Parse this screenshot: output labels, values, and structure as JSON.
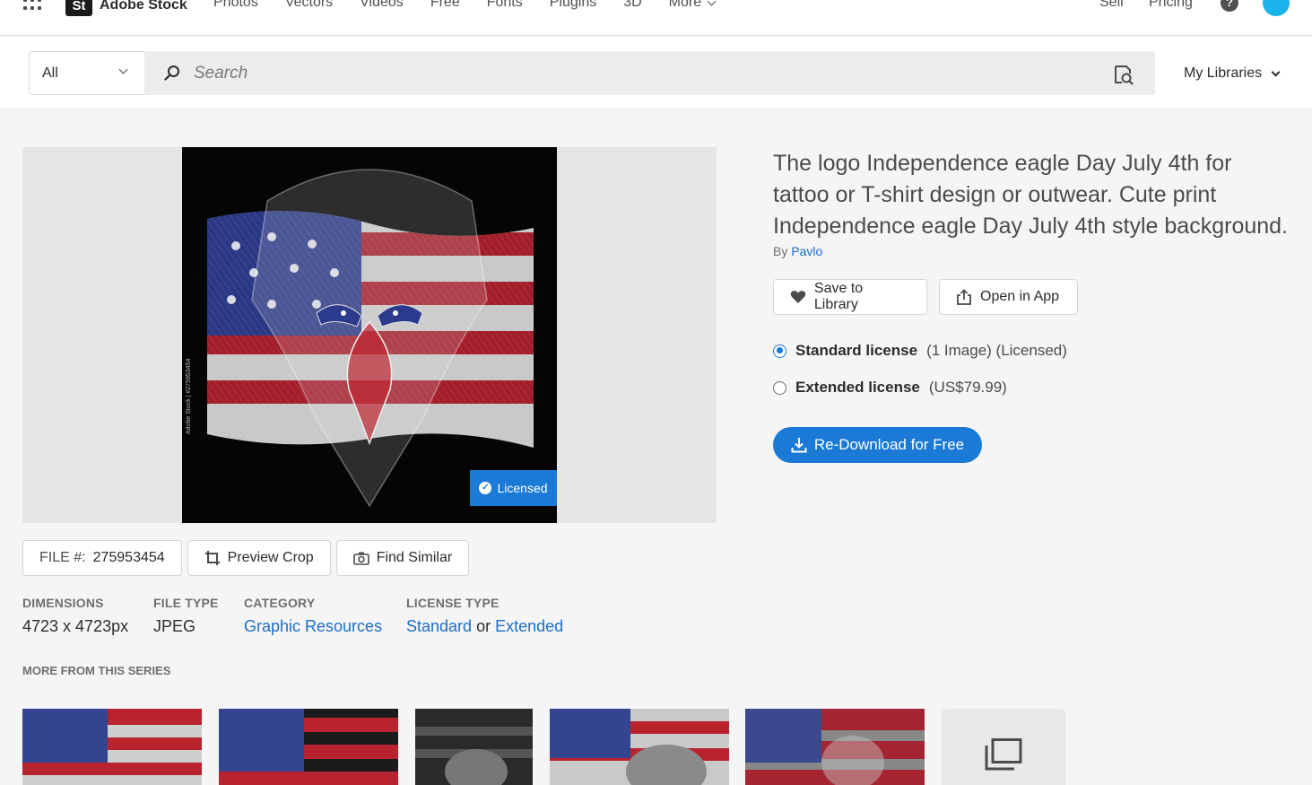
{
  "nav": {
    "logo_badge": "St",
    "brand": "Adobe Stock",
    "links": [
      "Photos",
      "Vectors",
      "Videos",
      "Free",
      "Fonts",
      "Plugins",
      "3D"
    ],
    "more_label": "More",
    "sell": "Sell",
    "pricing": "Pricing",
    "help": "?"
  },
  "search": {
    "scope": "All",
    "placeholder": "Search",
    "my_libraries": "My Libraries"
  },
  "asset": {
    "licensed_badge": "Licensed",
    "side_credit": "Adobe Stock | #275953454",
    "file_label": "FILE #:",
    "file_number": "275953454",
    "preview_crop": "Preview Crop",
    "find_similar": "Find Similar",
    "title": "The logo Independence eagle Day July 4th for tattoo or T-shirt design or outwear. Cute print Independence eagle Day July 4th style background.",
    "by": "By",
    "author": "Pavlo",
    "save_to_library": "Save to Library",
    "open_in_app": "Open in App"
  },
  "license": {
    "standard_name": "Standard license",
    "standard_detail": "(1 Image) (Licensed)",
    "extended_name": "Extended license",
    "extended_detail": "(US$79.99)",
    "redownload": "Re-Download for Free"
  },
  "meta": {
    "dimensions_label": "DIMENSIONS",
    "dimensions": "4723 x 4723px",
    "filetype_label": "FILE TYPE",
    "filetype": "JPEG",
    "category_label": "CATEGORY",
    "category": "Graphic Resources",
    "license_type_label": "LICENSE TYPE",
    "license_standard": "Standard",
    "license_or": "or",
    "license_extended": "Extended"
  },
  "series": {
    "heading": "MORE FROM THIS SERIES"
  },
  "colors": {
    "accent": "#1a7ad6",
    "link": "#1a6fc9",
    "flag_red": "#b8232e",
    "flag_blue": "#2b3a8c"
  }
}
